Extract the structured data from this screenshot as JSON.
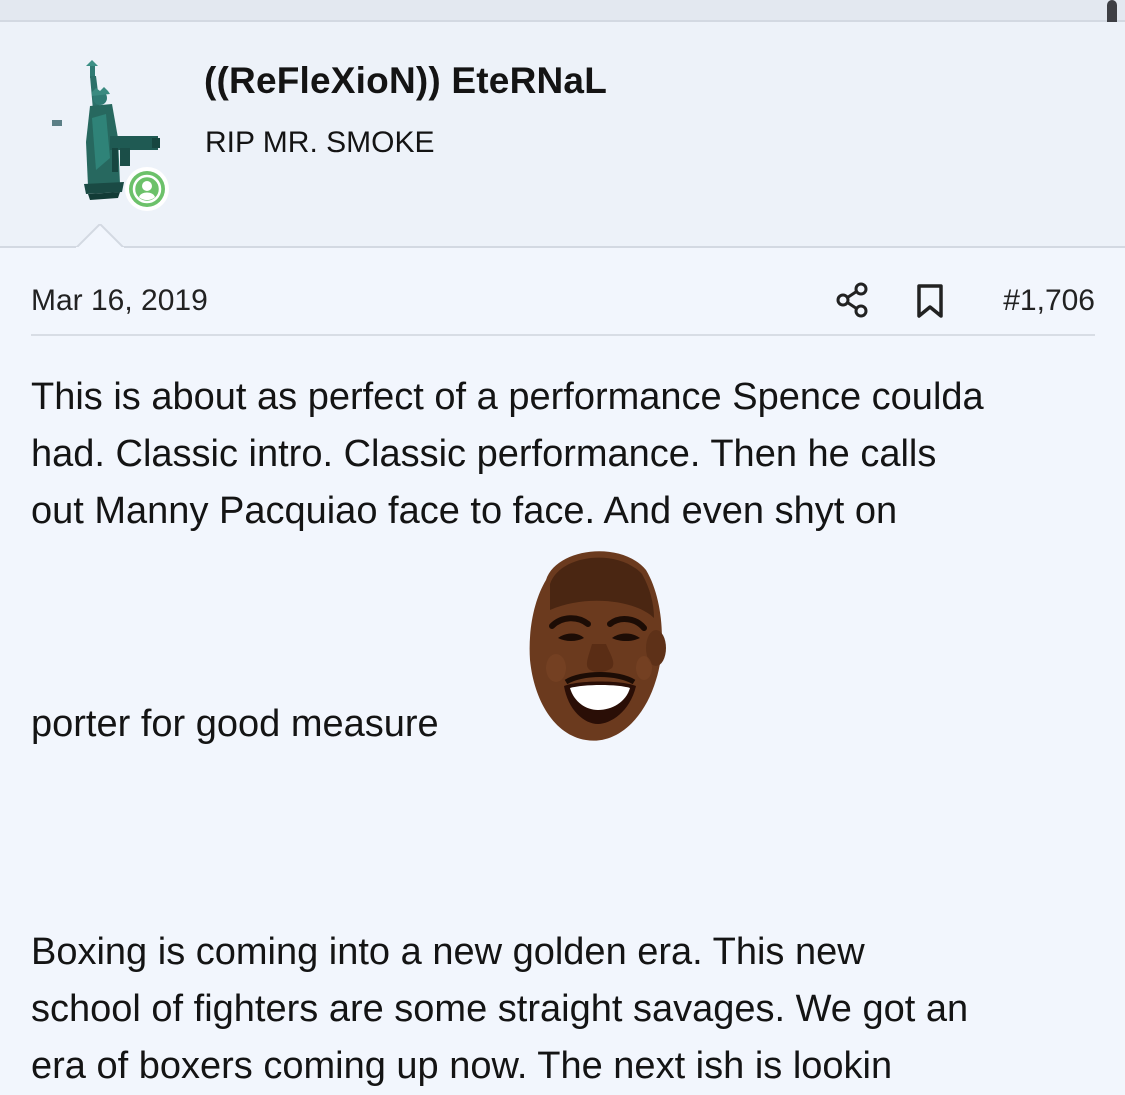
{
  "user": {
    "name": "((ReFleXioN)) EteRNaL",
    "title": "RIP MR. SMOKE",
    "online": true
  },
  "post": {
    "date": "Mar 16, 2019",
    "number": "#1,706",
    "paragraph1": [
      "This is about as perfect of a performance Spence coulda",
      "had. Classic intro. Classic performance. Then he calls",
      "out Manny Pacquiao face to face. And even shyt on"
    ],
    "paragraph1_end": "porter for good measure",
    "paragraph2": [
      "Boxing is coming into a new golden era. This new",
      "school of fighters are some straight savages. We got an",
      "era of boxers coming up now. The next ish is lookin"
    ]
  },
  "icons": {
    "share": "share-icon",
    "bookmark": "bookmark-icon",
    "avatar": "statue-of-liberty-avatar",
    "online": "online-user-icon",
    "smiley": "grinning-face-emoji"
  },
  "colors": {
    "online_green": "#6cc16a",
    "header_bg": "#edf2f9",
    "body_bg": "#f2f6fd",
    "text": "#141414"
  }
}
